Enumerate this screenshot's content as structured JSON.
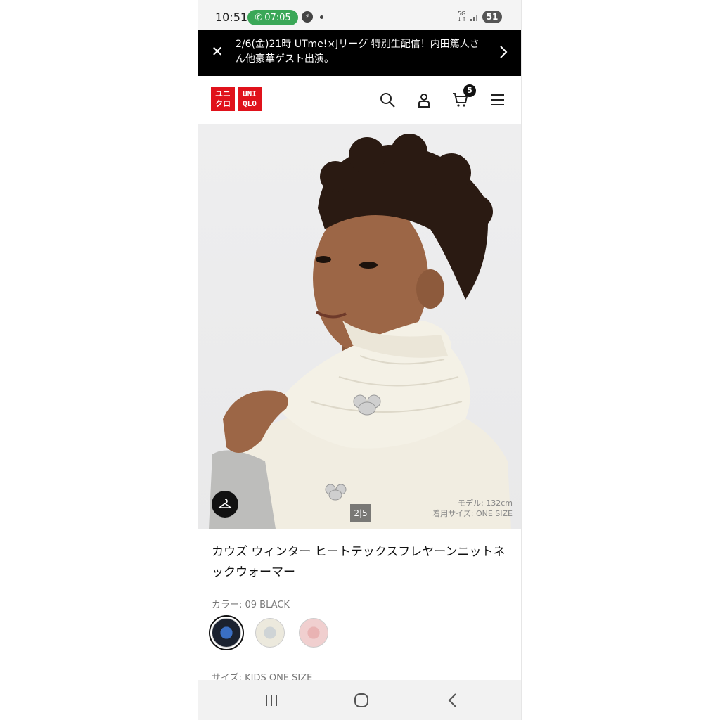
{
  "status_bar": {
    "time": "10:51",
    "call_duration": "07:05",
    "network": "5G",
    "battery": "51"
  },
  "banner": {
    "text": "2/6(金)21時 UTme!×Jリーグ 特別生配信！内田篤人さん他豪華ゲスト出演。"
  },
  "header": {
    "logo_top": [
      "ユニ",
      "クロ"
    ],
    "logo_right": [
      "UNI",
      "QLO"
    ],
    "cart_count": "5",
    "brand_color": "#e0121b"
  },
  "product_image": {
    "counter": "2|5",
    "model_line1": "モデル: 132cm",
    "model_line2": "着用サイズ: ONE SIZE"
  },
  "product": {
    "title": "カウズ ウィンター ヒートテックスフレヤーンニットネックウォーマー",
    "color_label": "カラー: 09 BLACK",
    "swatches": [
      {
        "name": "black",
        "color": "#1b2230",
        "selected": true
      },
      {
        "name": "off-white",
        "color": "#ece9dd",
        "selected": false
      },
      {
        "name": "pink",
        "color": "#f0cfcf",
        "selected": false
      }
    ],
    "size_label": "サイズ: KIDS ONE SIZE"
  }
}
